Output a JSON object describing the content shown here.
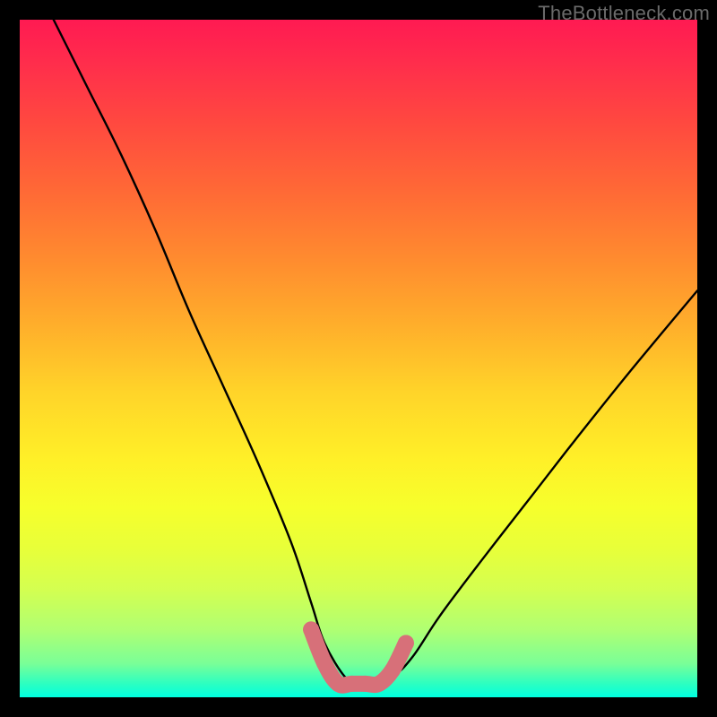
{
  "watermark": "TheBottleneck.com",
  "chart_data": {
    "type": "line",
    "title": "",
    "xlabel": "",
    "ylabel": "",
    "xlim": [
      0,
      100
    ],
    "ylim": [
      0,
      100
    ],
    "series": [
      {
        "name": "black-curve",
        "x": [
          5,
          10,
          15,
          20,
          25,
          30,
          35,
          40,
          43,
          45,
          48,
          50,
          52,
          55,
          58,
          62,
          68,
          75,
          82,
          90,
          100
        ],
        "values": [
          100,
          90,
          80,
          69,
          57,
          46,
          35,
          23,
          14,
          8,
          3,
          2,
          2,
          3,
          6,
          12,
          20,
          29,
          38,
          48,
          60
        ]
      },
      {
        "name": "pink-U",
        "x": [
          43,
          45,
          47,
          49,
          51,
          53,
          55,
          57
        ],
        "values": [
          10,
          5,
          2,
          2,
          2,
          2,
          4,
          8
        ]
      }
    ],
    "colors": {
      "black_curve": "#000000",
      "pink_u": "#d77079",
      "background_top": "#ff1a52",
      "background_bottom": "#00ffe0",
      "frame": "#000000",
      "watermark": "#6a6a6a"
    }
  }
}
